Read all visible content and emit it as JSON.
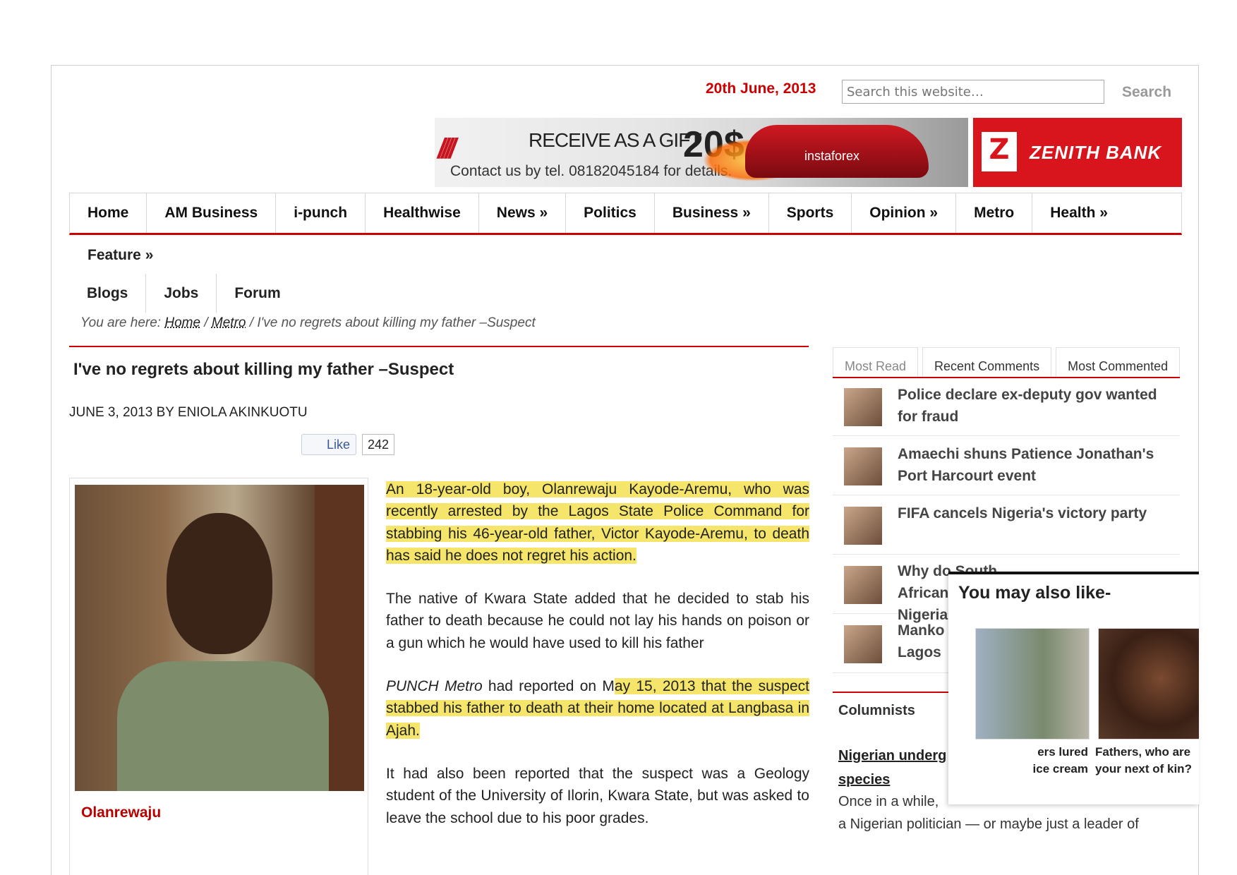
{
  "header": {
    "date": "20th June, 2013",
    "search_placeholder": "Search this website…",
    "search_button": "Search"
  },
  "banner": {
    "gift": "RECEIVE AS A GIFT",
    "amount": "20$",
    "contact": "Contact us by tel. 08182045184 for details.",
    "brand": "instaforex"
  },
  "zenith": {
    "logo": "Z",
    "name": "ZENITH BANK"
  },
  "nav": {
    "row1": [
      "Home",
      "AM Business",
      "i-punch",
      "Healthwise",
      "News »",
      "Politics",
      "Business »",
      "Sports",
      "Opinion »",
      "Metro",
      "Health »"
    ],
    "row2": [
      "Feature »"
    ],
    "row3": [
      "Blogs",
      "Jobs",
      "Forum"
    ]
  },
  "breadcrumb": {
    "prefix": "You are here:",
    "home": "Home",
    "sep1": "/",
    "metro": "Metro",
    "sep2": "/",
    "current": "I've no regrets about killing my father –Suspect"
  },
  "article": {
    "headline": "I've no regrets about killing my father –Suspect",
    "byline": "JUNE 3, 2013 BY ENIOLA AKINKUOTU",
    "like_label": "Like",
    "like_count": "242",
    "photo_caption": "Olanrewaju",
    "p1": "An 18-year-old boy, Olanrewaju Kayode-Aremu, who was recently arrested by the Lagos State Police Command for stabbing his 46-year-old father, Victor Kayode-Aremu, to death has said he does not regret his action.",
    "p2": "The native of Kwara State added that he decided to stab his father to death because he could not lay his hands on poison or a gun which he would have used to kill his father",
    "p3_italic": "PUNCH Metro",
    "p3_plain": " had reported on M",
    "p3_highlight": "ay 15, 2013 that the suspect stabbed his father to death at their home located at Langbasa in Ajah.",
    "p4": "It had also been reported that the suspect was a Geology student of the University of Ilorin, Kwara State, but was asked to leave the school due to his poor grades."
  },
  "sidebar": {
    "tabs": [
      "Most Read",
      "Recent Comments",
      "Most Commented"
    ],
    "items": [
      {
        "title": "Police declare ex-deputy gov wanted for fraud"
      },
      {
        "title": "Amaechi shuns Patience Jonathan's Port Harcourt event"
      },
      {
        "title": "FIFA cancels Nigeria's victory party"
      },
      {
        "title": "Why do South Africans hate Nigeria"
      },
      {
        "title": "Manko Lagos"
      }
    ],
    "columnists_label": "Columnists",
    "col_link_1": "Nigerian underg",
    "col_link_2": "species",
    "col_text_1": "Once in a while,",
    "col_text_2": "a Nigerian politician — or maybe just a leader of"
  },
  "popup": {
    "title": "You may also like-",
    "card1_line1": "ers lured",
    "card1_line2": "ice cream",
    "card2_line1": "Fathers, who are",
    "card2_line2": "your next of kin?"
  }
}
